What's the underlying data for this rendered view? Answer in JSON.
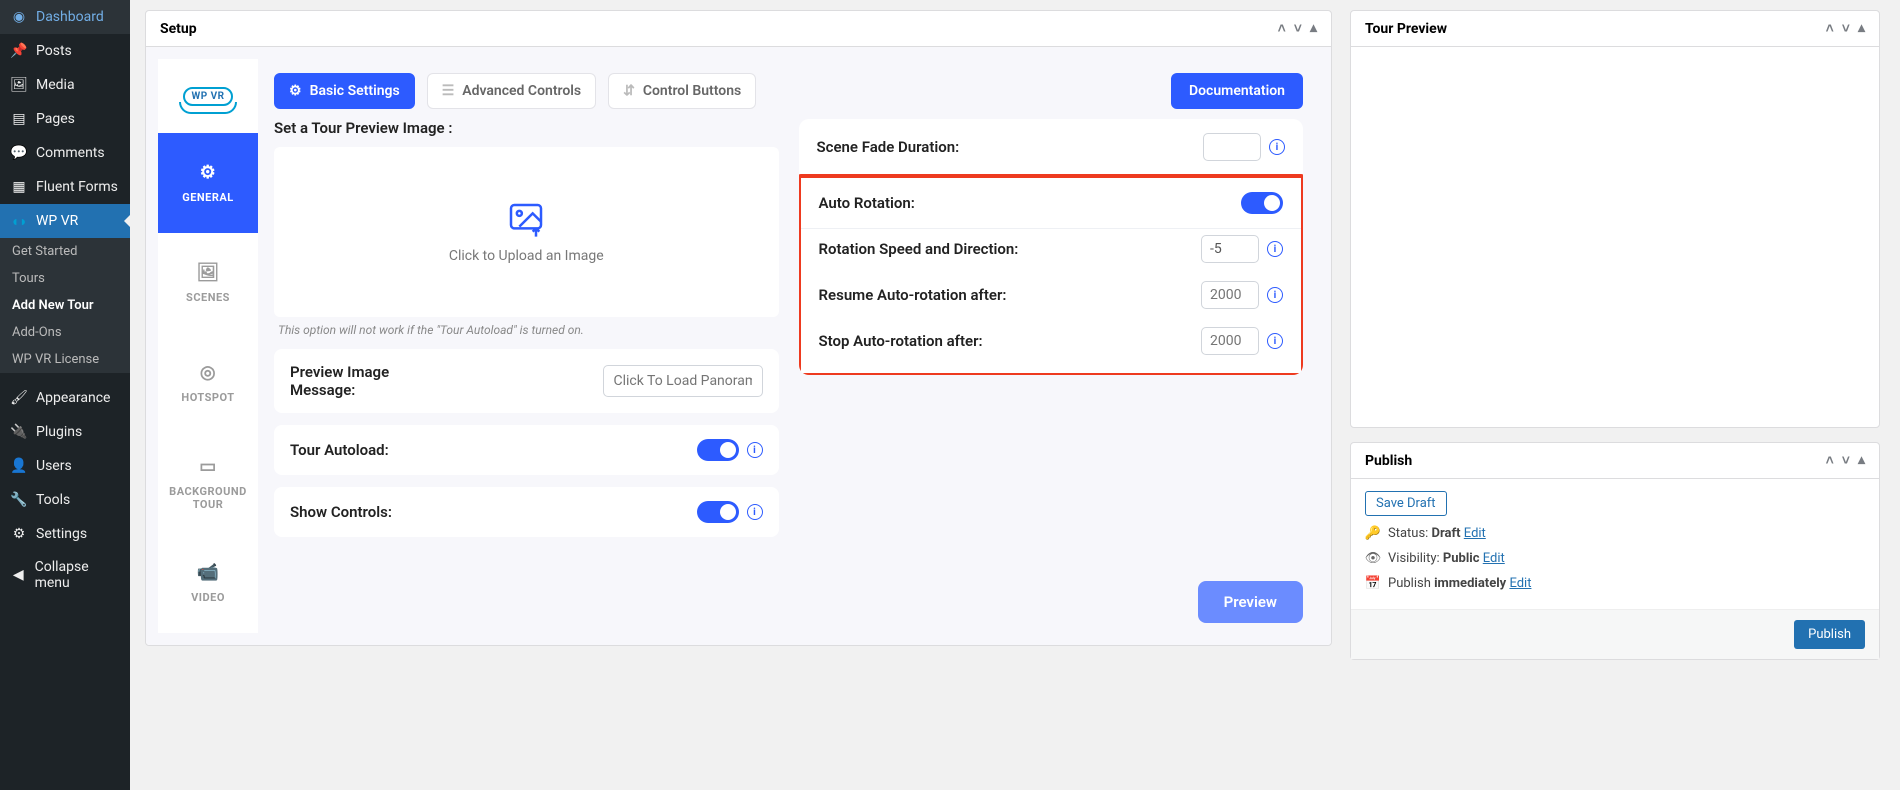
{
  "sidebar": {
    "items": [
      {
        "icon": "dashboard",
        "label": "Dashboard"
      },
      {
        "icon": "pin",
        "label": "Posts"
      },
      {
        "icon": "media",
        "label": "Media"
      },
      {
        "icon": "page",
        "label": "Pages"
      },
      {
        "icon": "comment",
        "label": "Comments"
      },
      {
        "icon": "form",
        "label": "Fluent Forms"
      },
      {
        "icon": "vr",
        "label": "WP VR"
      }
    ],
    "submenu": [
      {
        "label": "Get Started"
      },
      {
        "label": "Tours"
      },
      {
        "label": "Add New Tour"
      },
      {
        "label": "Add-Ons"
      },
      {
        "label": "WP VR License"
      }
    ],
    "items2": [
      {
        "icon": "brush",
        "label": "Appearance"
      },
      {
        "icon": "plug",
        "label": "Plugins"
      },
      {
        "icon": "user",
        "label": "Users"
      },
      {
        "icon": "wrench",
        "label": "Tools"
      },
      {
        "icon": "settings",
        "label": "Settings"
      },
      {
        "icon": "collapse",
        "label": "Collapse menu"
      }
    ]
  },
  "panels": {
    "setup_title": "Setup",
    "tour_preview_title": "Tour Preview",
    "publish_title": "Publish"
  },
  "vtabs": {
    "logo_text": "WP VR",
    "general": "GENERAL",
    "scenes": "SCENES",
    "hotspot": "HOTSPOT",
    "background_tour": "BACKGROUND TOUR",
    "video": "VIDEO"
  },
  "top_tabs": {
    "basic": "Basic Settings",
    "advanced": "Advanced Controls",
    "control": "Control Buttons",
    "documentation": "Documentation"
  },
  "left_settings": {
    "preview_label": "Set a Tour Preview Image :",
    "upload_text": "Click to Upload an Image",
    "autoload_note": "This option will not work if the \"Tour Autoload\" is turned on.",
    "preview_msg_label": "Preview Image Message:",
    "preview_msg_placeholder": "Click To Load Panoram",
    "tour_autoload_label": "Tour Autoload:",
    "show_controls_label": "Show Controls:"
  },
  "right_settings": {
    "scene_fade_label": "Scene Fade Duration:",
    "auto_rotation_label": "Auto Rotation:",
    "rotation_speed_label": "Rotation Speed and Direction:",
    "rotation_speed_value": "-5",
    "resume_label": "Resume Auto-rotation after:",
    "resume_placeholder": "2000",
    "stop_label": "Stop Auto-rotation after:",
    "stop_placeholder": "2000"
  },
  "preview_button": "Preview",
  "publish": {
    "save_draft": "Save Draft",
    "status_label": "Status: ",
    "status_value": "Draft",
    "status_edit": "Edit",
    "visibility_label": "Visibility: ",
    "visibility_value": "Public",
    "visibility_edit": "Edit",
    "publish_label": "Publish ",
    "publish_value": "immediately",
    "publish_edit": "Edit",
    "publish_button": "Publish"
  }
}
